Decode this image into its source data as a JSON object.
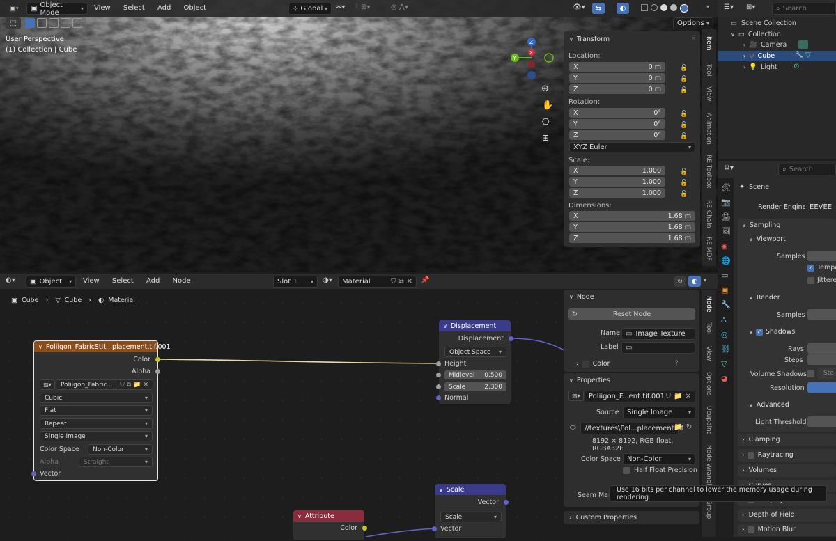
{
  "viewport_header": {
    "mode": "Object Mode",
    "menu": [
      "View",
      "Select",
      "Add",
      "Object"
    ],
    "orientation": "Global",
    "options": "Options"
  },
  "viewport": {
    "perspective": "User Perspective",
    "collection": "(1) Collection | Cube",
    "gizmo": {
      "z": "Z",
      "y": "Y",
      "x": "X"
    }
  },
  "transform": {
    "title": "Transform",
    "location_label": "Location:",
    "location": [
      {
        "axis": "X",
        "value": "0 m"
      },
      {
        "axis": "Y",
        "value": "0 m"
      },
      {
        "axis": "Z",
        "value": "0 m"
      }
    ],
    "rotation_label": "Rotation:",
    "rotation": [
      {
        "axis": "X",
        "value": "0°"
      },
      {
        "axis": "Y",
        "value": "0°"
      },
      {
        "axis": "Z",
        "value": "0°"
      }
    ],
    "rotation_mode": "XYZ Euler",
    "scale_label": "Scale:",
    "scale": [
      {
        "axis": "X",
        "value": "1.000"
      },
      {
        "axis": "Y",
        "value": "1.000"
      },
      {
        "axis": "Z",
        "value": "1.000"
      }
    ],
    "dimensions_label": "Dimensions:",
    "dimensions": [
      {
        "axis": "X",
        "value": "1.68 m"
      },
      {
        "axis": "Y",
        "value": "1.68 m"
      },
      {
        "axis": "Z",
        "value": "1.68 m"
      }
    ]
  },
  "viewport_tabs": [
    "Item",
    "Tool",
    "View",
    "Animation",
    "RE Toolbox",
    "RE Chain",
    "RE MDF"
  ],
  "outliner": {
    "search_placeholder": "Search",
    "scene_collection": "Scene Collection",
    "collection": "Collection",
    "items": [
      "Camera",
      "Cube",
      "Light"
    ]
  },
  "properties": {
    "search_placeholder": "Search",
    "scene": "Scene",
    "render_engine_label": "Render Engine",
    "render_engine": "EEVEE",
    "sampling": "Sampling",
    "viewport": "Viewport",
    "samples": "Samples",
    "temporal": "Tempo",
    "jittered": "Jittered",
    "render": "Render",
    "render_samples": "Samples",
    "shadows": "Shadows",
    "rays": "Rays",
    "steps": "Steps",
    "volume_shadows": "Volume Shadows",
    "vs_value": "Ste",
    "resolution": "Resolution",
    "advanced": "Advanced",
    "light_threshold": "Light Threshold",
    "sections": [
      "Clamping",
      "Raytracing",
      "Volumes",
      "Curves",
      "Simplify",
      "Depth of Field",
      "Motion Blur"
    ]
  },
  "node_header": {
    "type": "Object",
    "menu": [
      "View",
      "Select",
      "Add",
      "Node"
    ],
    "slot": "Slot 1",
    "material": "Material"
  },
  "breadcrumb": [
    "Cube",
    "Cube",
    "Material"
  ],
  "texture_node": {
    "title": "Poliigon_FabricStit...placement.tif.001",
    "out_color": "Color",
    "out_alpha": "Alpha",
    "image": "Poliigon_Fabric...",
    "interpolation": "Cubic",
    "projection": "Flat",
    "extension": "Repeat",
    "source": "Single Image",
    "color_space_label": "Color Space",
    "color_space": "Non-Color",
    "alpha_label": "Alpha",
    "alpha": "Straight",
    "vector": "Vector"
  },
  "displacement_node": {
    "title": "Displacement",
    "output": "Displacement",
    "space": "Object Space",
    "height": "Height",
    "midlevel_label": "Midlevel",
    "midlevel": "0.500",
    "scale_label": "Scale",
    "scale": "2.300",
    "normal": "Normal"
  },
  "scale_node": {
    "title": "Scale",
    "output": "Vector",
    "op": "Scale",
    "input": "Vector"
  },
  "attribute_node": {
    "title": "Attribute",
    "output": "Color"
  },
  "node_panel": {
    "title": "Node",
    "reset": "Reset Node",
    "name_label": "Name",
    "name": "Image Texture",
    "label_label": "Label",
    "label": "",
    "color": "Color",
    "properties": "Properties",
    "image": "Poliigon_F...ent.tif.001",
    "source_label": "Source",
    "source": "Single Image",
    "path": "//textures\\Pol...placement.tif",
    "info": "8192 × 8192,  RGB float, RGBA32F",
    "color_space_label": "Color Space",
    "color_space": "Non-Color",
    "half_float": "Half Float Precision",
    "seam": "Seam Marg",
    "custom_props": "Custom Properties"
  },
  "node_tabs": [
    "Node",
    "Tool",
    "View",
    "Options",
    "Ucupaint",
    "Node Wrangler",
    "Group"
  ],
  "tooltip": "Use 16 bits per channel to lower the memory usage during rendering.",
  "colors": {
    "texture_header": "#8a4d1c",
    "vector_header": "#3b3b8c",
    "attribute_header": "#8a2c3d",
    "selected": "#2d4b78",
    "accent": "#4772b3"
  }
}
